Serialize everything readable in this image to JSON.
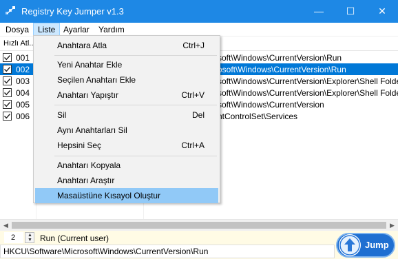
{
  "window": {
    "title": "Registry Key Jumper v1.3",
    "min_glyph": "—",
    "max_glyph": "☐",
    "close_glyph": "✕"
  },
  "menubar": {
    "items": [
      "Dosya",
      "Liste",
      "Ayarlar",
      "Yardım"
    ],
    "active": "Liste"
  },
  "list": {
    "header_hotkey": "Hızlı Atl...",
    "rows": [
      {
        "id": "001",
        "path": "soft\\Windows\\CurrentVersion\\Run",
        "checked": true,
        "selected": false
      },
      {
        "id": "002",
        "path": "osoft\\Windows\\CurrentVersion\\Run",
        "checked": true,
        "selected": true
      },
      {
        "id": "003",
        "path": "soft\\Windows\\CurrentVersion\\Explorer\\Shell Folders",
        "checked": true,
        "selected": false
      },
      {
        "id": "004",
        "path": "soft\\Windows\\CurrentVersion\\Explorer\\Shell Folders",
        "checked": true,
        "selected": false
      },
      {
        "id": "005",
        "path": "soft\\Windows\\CurrentVersion",
        "checked": true,
        "selected": false
      },
      {
        "id": "006",
        "path": "ntControlSet\\Services",
        "checked": true,
        "selected": false
      }
    ]
  },
  "dropdown": {
    "items": [
      {
        "label": "Anahtara Atla",
        "shortcut": "Ctrl+J"
      },
      {
        "label": "Yeni Anahtar Ekle",
        "shortcut": ""
      },
      {
        "label": "Seçilen Anahtarı Ekle",
        "shortcut": ""
      },
      {
        "label": "Anahtarı Yapıştır",
        "shortcut": "Ctrl+V"
      },
      {
        "label": "Sil",
        "shortcut": "Del"
      },
      {
        "label": "Aynı Anahtarları Sil",
        "shortcut": ""
      },
      {
        "label": "Hepsini Seç",
        "shortcut": "Ctrl+A"
      },
      {
        "label": "Anahtarı Kopyala",
        "shortcut": ""
      },
      {
        "label": "Anahtarı Araştır",
        "shortcut": ""
      },
      {
        "label": "Masaüstüne Kısayol Oluştur",
        "shortcut": ""
      }
    ],
    "highlighted": "Masaüstüne Kısayol Oluştur"
  },
  "bottom": {
    "count": "2",
    "status": "Run (Current user)",
    "path": "HKCU\\Software\\Microsoft\\Windows\\CurrentVersion\\Run",
    "jump_label": "Jump"
  },
  "colors": {
    "titlebar": "#1e88e5",
    "selection": "#0078d7",
    "menu_highlight": "#91c9f7",
    "bottom_panel": "#fffbe5",
    "jump_button": "#1f6fd1"
  }
}
